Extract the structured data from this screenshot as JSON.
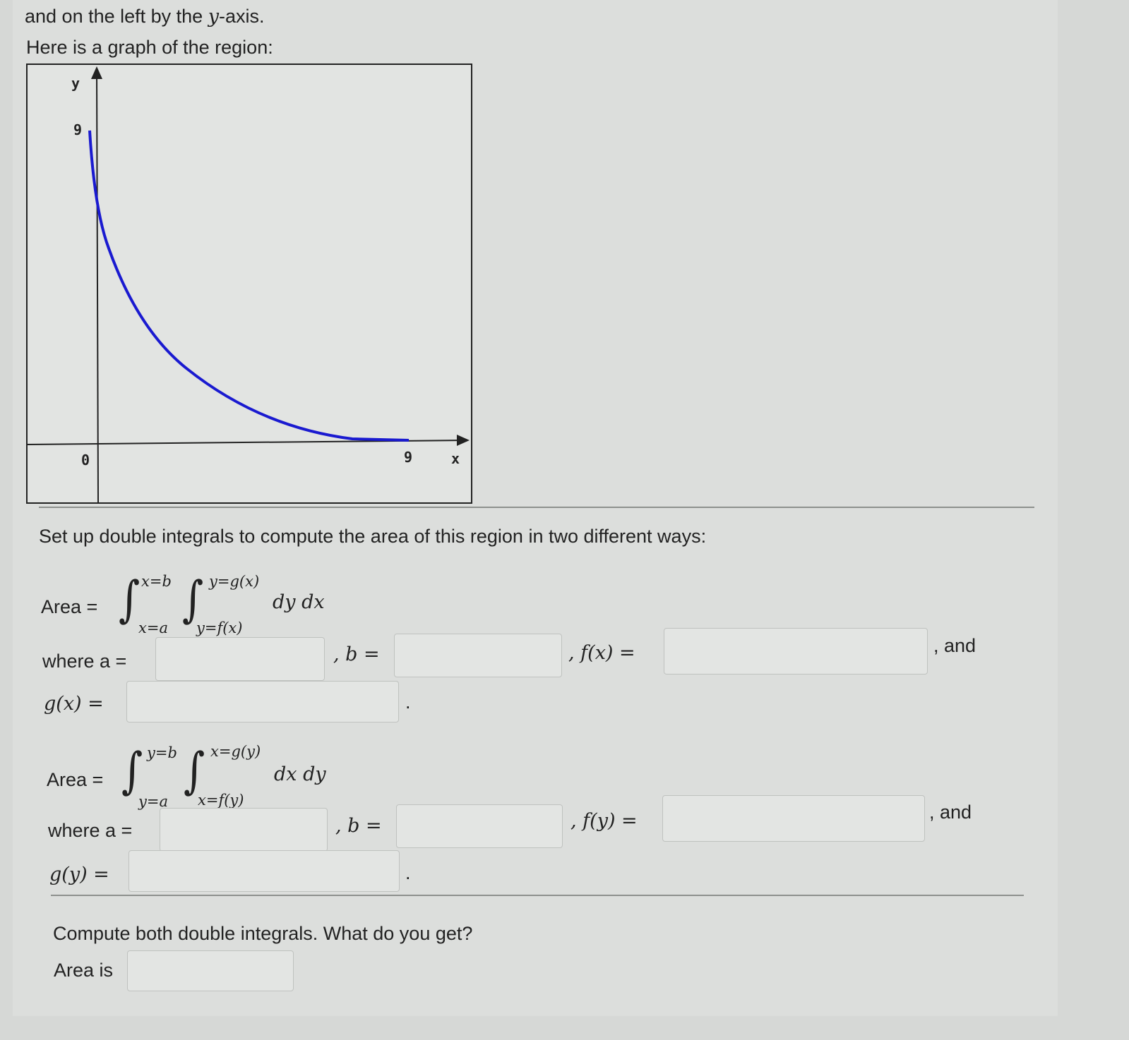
{
  "intro": {
    "line1_prefix": "and on the left by the ",
    "line1_var": "y",
    "line1_suffix": "-axis.",
    "line2": "Here is a graph of the region:"
  },
  "graph": {
    "y_label": "y",
    "x_label": "x",
    "y_tick": "9",
    "origin": "0",
    "x_tick": "9",
    "curve_color": "#1a1ad0"
  },
  "instructions": "Set up double integrals to compute the area of this region in two different ways:",
  "part1": {
    "area_label": "Area =",
    "upper_outer": "x=b",
    "lower_outer": "x=a",
    "upper_inner": "y=g(x)",
    "lower_inner": "y=f(x)",
    "differential": "dy dx",
    "where_a": "where a =",
    "b_label": ", b =",
    "f_label": ", f(x) =",
    "and": ", and",
    "g_label": "g(x) =",
    "period": ".",
    "a_value": "",
    "b_value": "",
    "f_value": "",
    "g_value": ""
  },
  "part2": {
    "area_label": "Area =",
    "upper_outer": "y=b",
    "lower_outer": "y=a",
    "upper_inner": "x=g(y)",
    "lower_inner": "x=f(y)",
    "differential": "dx dy",
    "where_a": "where a =",
    "b_label": ", b =",
    "f_label": ", f(y) =",
    "and": ", and",
    "g_label": "g(y) =",
    "period": ".",
    "a_value": "",
    "b_value": "",
    "f_value": "",
    "g_value": ""
  },
  "compute": {
    "question": "Compute both double integrals. What do you get?",
    "area_is": "Area is",
    "value": ""
  }
}
